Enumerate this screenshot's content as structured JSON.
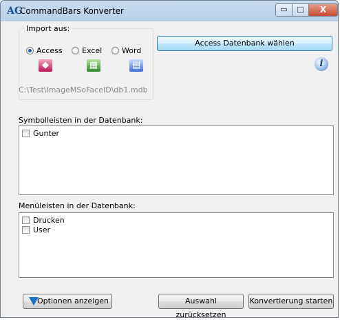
{
  "window": {
    "title": "CommandBars Konverter",
    "app_icon": "AG",
    "controls": {
      "minimize": "▭",
      "maximize": "□",
      "close": "X"
    }
  },
  "import_group": {
    "legend": "Import aus:",
    "options": [
      {
        "label": "Access",
        "selected": true,
        "icon": "access-file-icon"
      },
      {
        "label": "Excel",
        "selected": false,
        "icon": "excel-file-icon"
      },
      {
        "label": "Word",
        "selected": false,
        "icon": "word-file-icon"
      }
    ]
  },
  "access_button": "Access Datenbank wählen",
  "info_icon": "i",
  "path": "C:\\Test\\ImageMSoFaceID\\db1.mdb",
  "symbolleisten": {
    "label": "Symbolleisten in der Datenbank:",
    "items": [
      {
        "label": "Gunter",
        "checked": false
      }
    ]
  },
  "menueleisten": {
    "label": "Menüleisten in der Datenbank:",
    "items": [
      {
        "label": "Drucken",
        "checked": false
      },
      {
        "label": "User",
        "checked": false
      }
    ]
  },
  "buttons": {
    "options": "Optionen anzeigen",
    "reset": "Auswahl zurücksetzen",
    "convert": "Konvertierung starten"
  }
}
